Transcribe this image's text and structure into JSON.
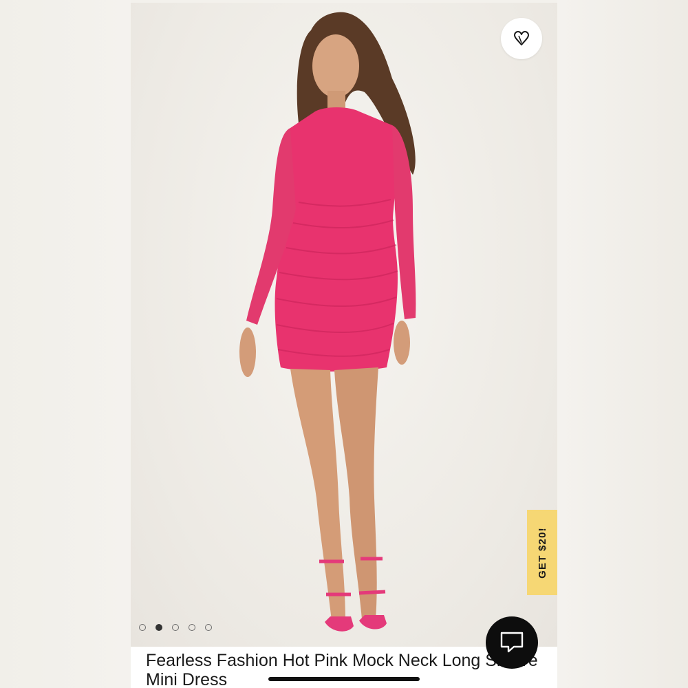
{
  "product": {
    "title": "Fearless Fashion Hot Pink Mock Neck Long Sleeve Mini Dress",
    "image_alt": "Model wearing hot pink mock neck long sleeve ruched mini dress",
    "dress_color": "#e8336e"
  },
  "gallery": {
    "total_images": 5,
    "active_index": 1
  },
  "promo": {
    "label": "GET $20!",
    "color": "#f6d774"
  },
  "icons": {
    "wishlist": "heart-icon",
    "chat": "chat-bubble-icon"
  }
}
